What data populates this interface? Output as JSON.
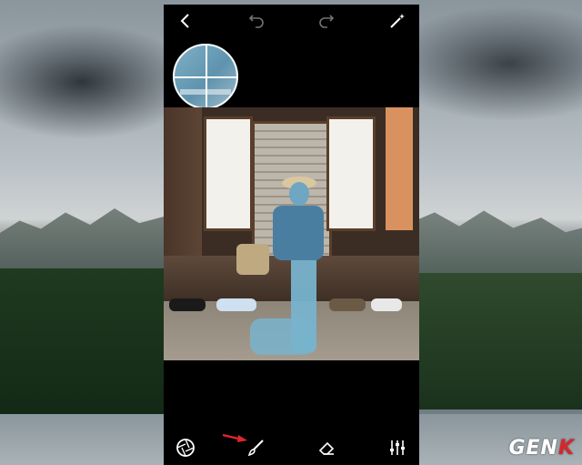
{
  "toolbar": {
    "back_icon": "chevron-left-icon",
    "undo_icon": "undo-icon",
    "redo_icon": "redo-icon",
    "magic_icon": "magic-wand-icon"
  },
  "bottom_tools": [
    {
      "name": "aperture",
      "icon": "aperture-icon"
    },
    {
      "name": "brush",
      "icon": "brush-icon",
      "active": true
    },
    {
      "name": "eraser",
      "icon": "eraser-icon"
    },
    {
      "name": "adjust",
      "icon": "sliders-icon"
    }
  ],
  "annotation": {
    "icon": "red-arrow-icon",
    "color": "#e0252b"
  },
  "watermark": {
    "logo_text": "GENK",
    "accent_color": "#d7262b"
  },
  "colors": {
    "mask": "#78b3cd",
    "app_bg": "#000000"
  }
}
